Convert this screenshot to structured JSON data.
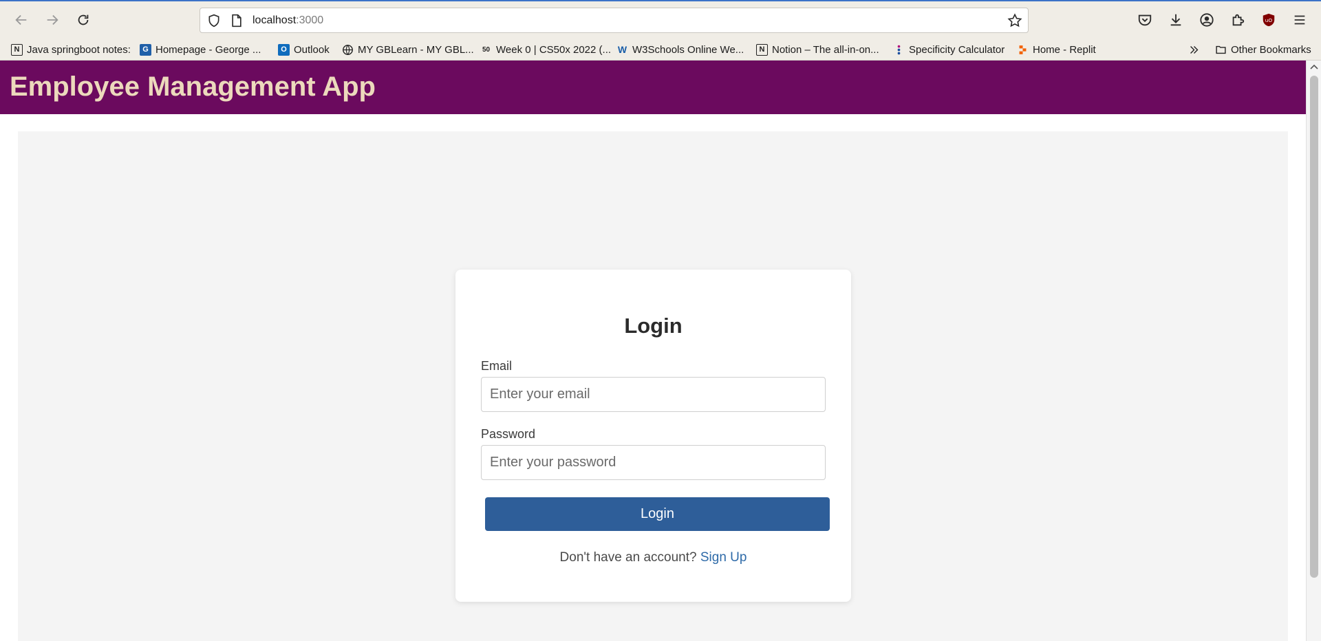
{
  "browser": {
    "url_host": "localhost",
    "url_port": ":3000",
    "bookmarks": [
      {
        "label": "Java springboot notes:",
        "icon": "notion-icon"
      },
      {
        "label": "Homepage - George ...",
        "icon": "george-brown-icon"
      },
      {
        "label": "Outlook",
        "icon": "outlook-icon"
      },
      {
        "label": "MY GBLearn - MY GBL...",
        "icon": "globe-icon"
      },
      {
        "label": "Week 0 | CS50x 2022 (...",
        "icon": "cs50-icon"
      },
      {
        "label": "W3Schools Online We...",
        "icon": "w3schools-icon"
      },
      {
        "label": "Notion – The all-in-on...",
        "icon": "notion-icon"
      },
      {
        "label": "Specificity Calculator",
        "icon": "specificity-icon"
      },
      {
        "label": "Home - Replit",
        "icon": "replit-icon"
      }
    ],
    "other_bookmarks": "Other Bookmarks"
  },
  "app": {
    "title": "Employee Management App"
  },
  "login": {
    "title": "Login",
    "email_label": "Email",
    "email_placeholder": "Enter your email",
    "password_label": "Password",
    "password_placeholder": "Enter your password",
    "button_label": "Login",
    "signup_prompt": "Don't have an account?",
    "signup_link": "Sign Up"
  },
  "colors": {
    "header_bg": "#6b0a5e",
    "header_text": "#ecd9bc",
    "button_bg": "#2e5e99",
    "link": "#2e6aa8"
  }
}
